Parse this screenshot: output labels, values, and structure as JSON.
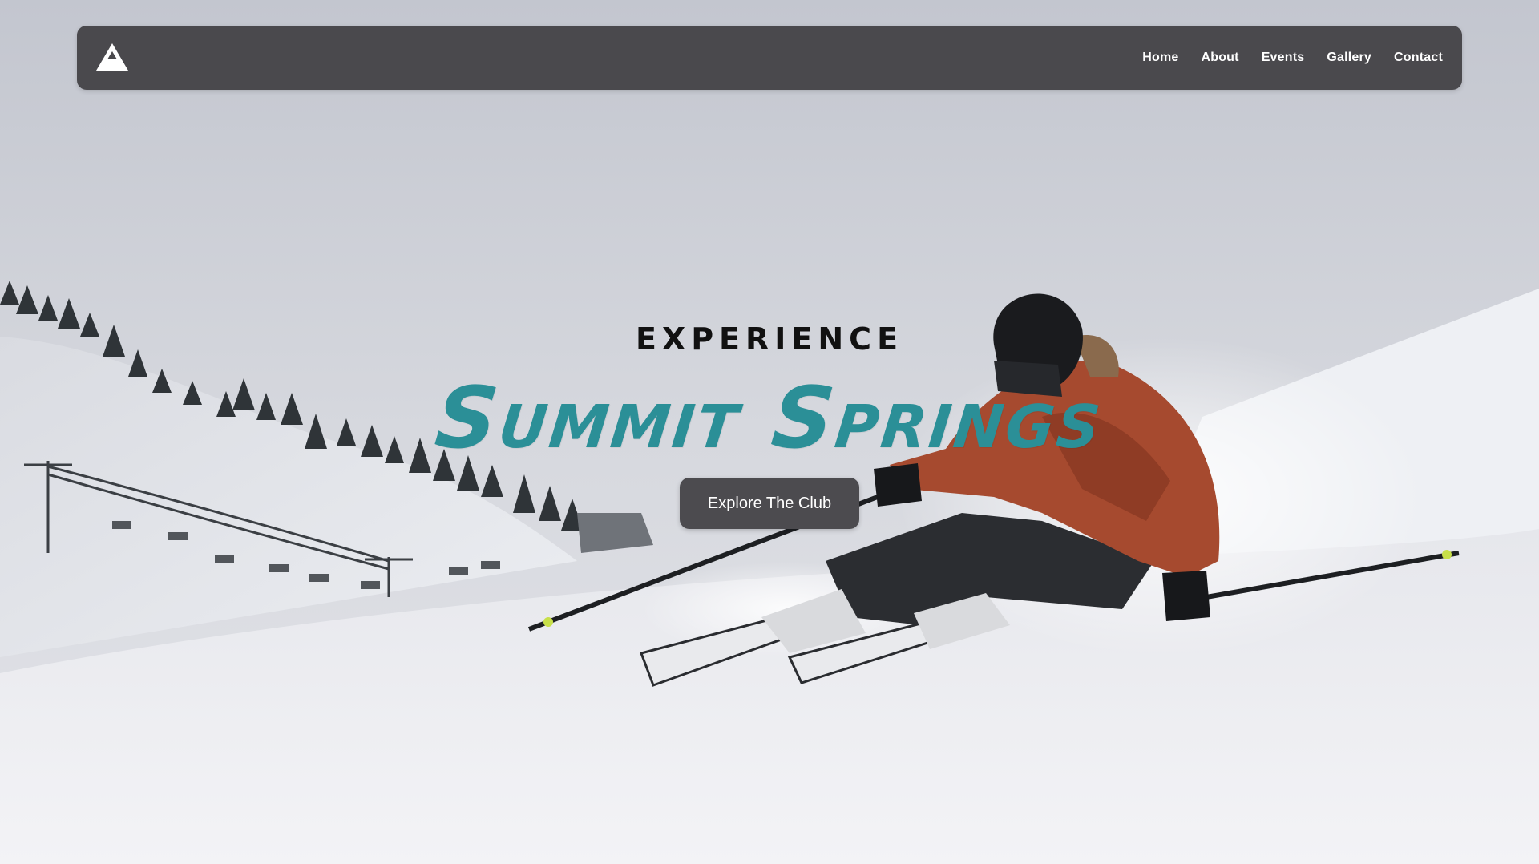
{
  "nav": {
    "logo": "mountain-icon",
    "links": [
      "Home",
      "About",
      "Events",
      "Gallery",
      "Contact"
    ]
  },
  "hero": {
    "kicker": "EXPERIENCE",
    "headline": "Summit Springs",
    "cta_label": "Explore The Club",
    "background_image": "skier-carving-snow-slope-photo"
  },
  "colors": {
    "navbar_bg": "#4a494d",
    "headline": "#2b8f97",
    "kicker": "#111111",
    "cta_bg": "#4c4b4f",
    "cta_text": "#ffffff"
  }
}
